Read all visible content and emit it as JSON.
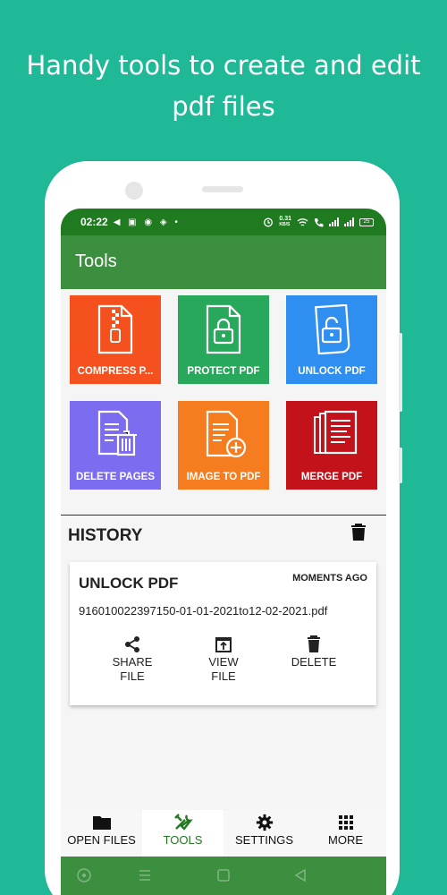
{
  "promo": {
    "line1": "Handy tools to create and edit",
    "line2": "pdf files"
  },
  "status_bar": {
    "time": "02:22",
    "left_icons": "◀ ▣ ◉ ◈ •",
    "net_speed_value": "0.31",
    "net_speed_unit": "KB/S",
    "battery": "25"
  },
  "appbar": {
    "title": "Tools"
  },
  "tools": [
    {
      "label": "COMPRESS P...",
      "icon": "zip-file-icon",
      "color": "#f4511e"
    },
    {
      "label": "PROTECT PDF",
      "icon": "lock-file-icon",
      "color": "#27a85a"
    },
    {
      "label": "UNLOCK PDF",
      "icon": "unlock-file-icon",
      "color": "#2e8ff0"
    },
    {
      "label": "DELETE PAGES",
      "icon": "delete-pages-icon",
      "color": "#7c6cf0"
    },
    {
      "label": "IMAGE TO PDF",
      "icon": "add-file-icon",
      "color": "#f57c1f"
    },
    {
      "label": "MERGE PDF",
      "icon": "merge-files-icon",
      "color": "#c4121b"
    }
  ],
  "history": {
    "title": "HISTORY",
    "card": {
      "title": "UNLOCK PDF",
      "time": "MOMENTS AGO",
      "file": "916010022397150-01-01-2021to12-02-2021.pdf",
      "actions": [
        {
          "line1": "SHARE",
          "line2": "FILE",
          "icon": "share-icon"
        },
        {
          "line1": "VIEW",
          "line2": "FILE",
          "icon": "open-external-icon"
        },
        {
          "line1": "DELETE",
          "line2": "",
          "icon": "trash-icon"
        }
      ]
    }
  },
  "bottom_nav": [
    {
      "label": "OPEN FILES",
      "icon": "folder-icon",
      "active": false
    },
    {
      "label": "TOOLS",
      "icon": "tools-icon",
      "active": true
    },
    {
      "label": "SETTINGS",
      "icon": "gear-icon",
      "active": false
    },
    {
      "label": "MORE",
      "icon": "grid-icon",
      "active": false
    }
  ],
  "colors": {
    "background": "#1fb998",
    "status_bar": "#1f7a20",
    "appbar": "#3b8f3e",
    "active_nav": "#1f7a20"
  }
}
